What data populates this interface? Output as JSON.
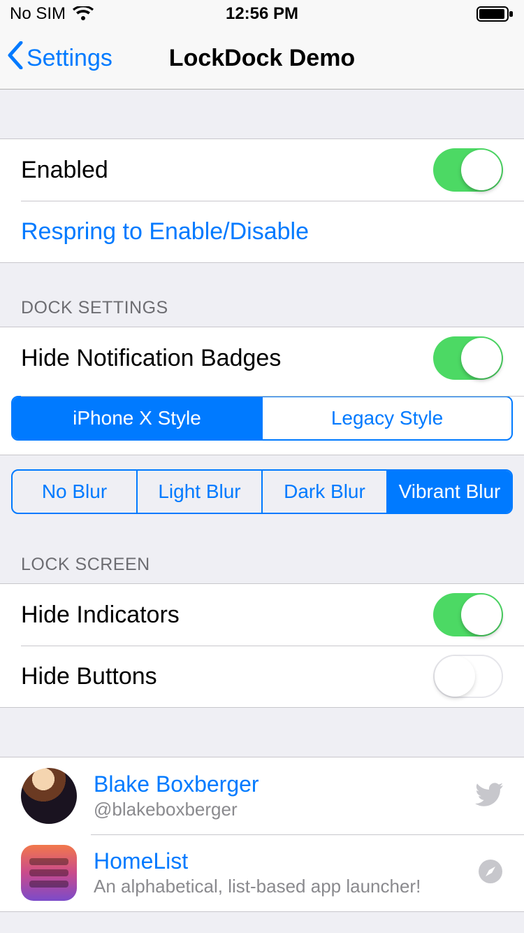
{
  "status": {
    "carrier": "No SIM",
    "time": "12:56 PM"
  },
  "nav": {
    "back": "Settings",
    "title": "LockDock Demo"
  },
  "group1": {
    "enabled_label": "Enabled",
    "enabled_on": true,
    "respring_label": "Respring to Enable/Disable"
  },
  "dock": {
    "header": "DOCK SETTINGS",
    "hide_badges_label": "Hide Notification Badges",
    "hide_badges_on": true,
    "style_segments": [
      "iPhone X Style",
      "Legacy Style"
    ],
    "style_selected": 0,
    "blur_segments": [
      "No Blur",
      "Light Blur",
      "Dark Blur",
      "Vibrant Blur"
    ],
    "blur_selected": 3
  },
  "lock": {
    "header": "LOCK SCREEN",
    "hide_indicators_label": "Hide Indicators",
    "hide_indicators_on": true,
    "hide_buttons_label": "Hide Buttons",
    "hide_buttons_on": false
  },
  "credits": [
    {
      "title": "Blake Boxberger",
      "sub": "@blakeboxberger",
      "accessory": "twitter"
    },
    {
      "title": "HomeList",
      "sub": "An alphabetical, list-based app launcher!",
      "accessory": "safari"
    }
  ]
}
